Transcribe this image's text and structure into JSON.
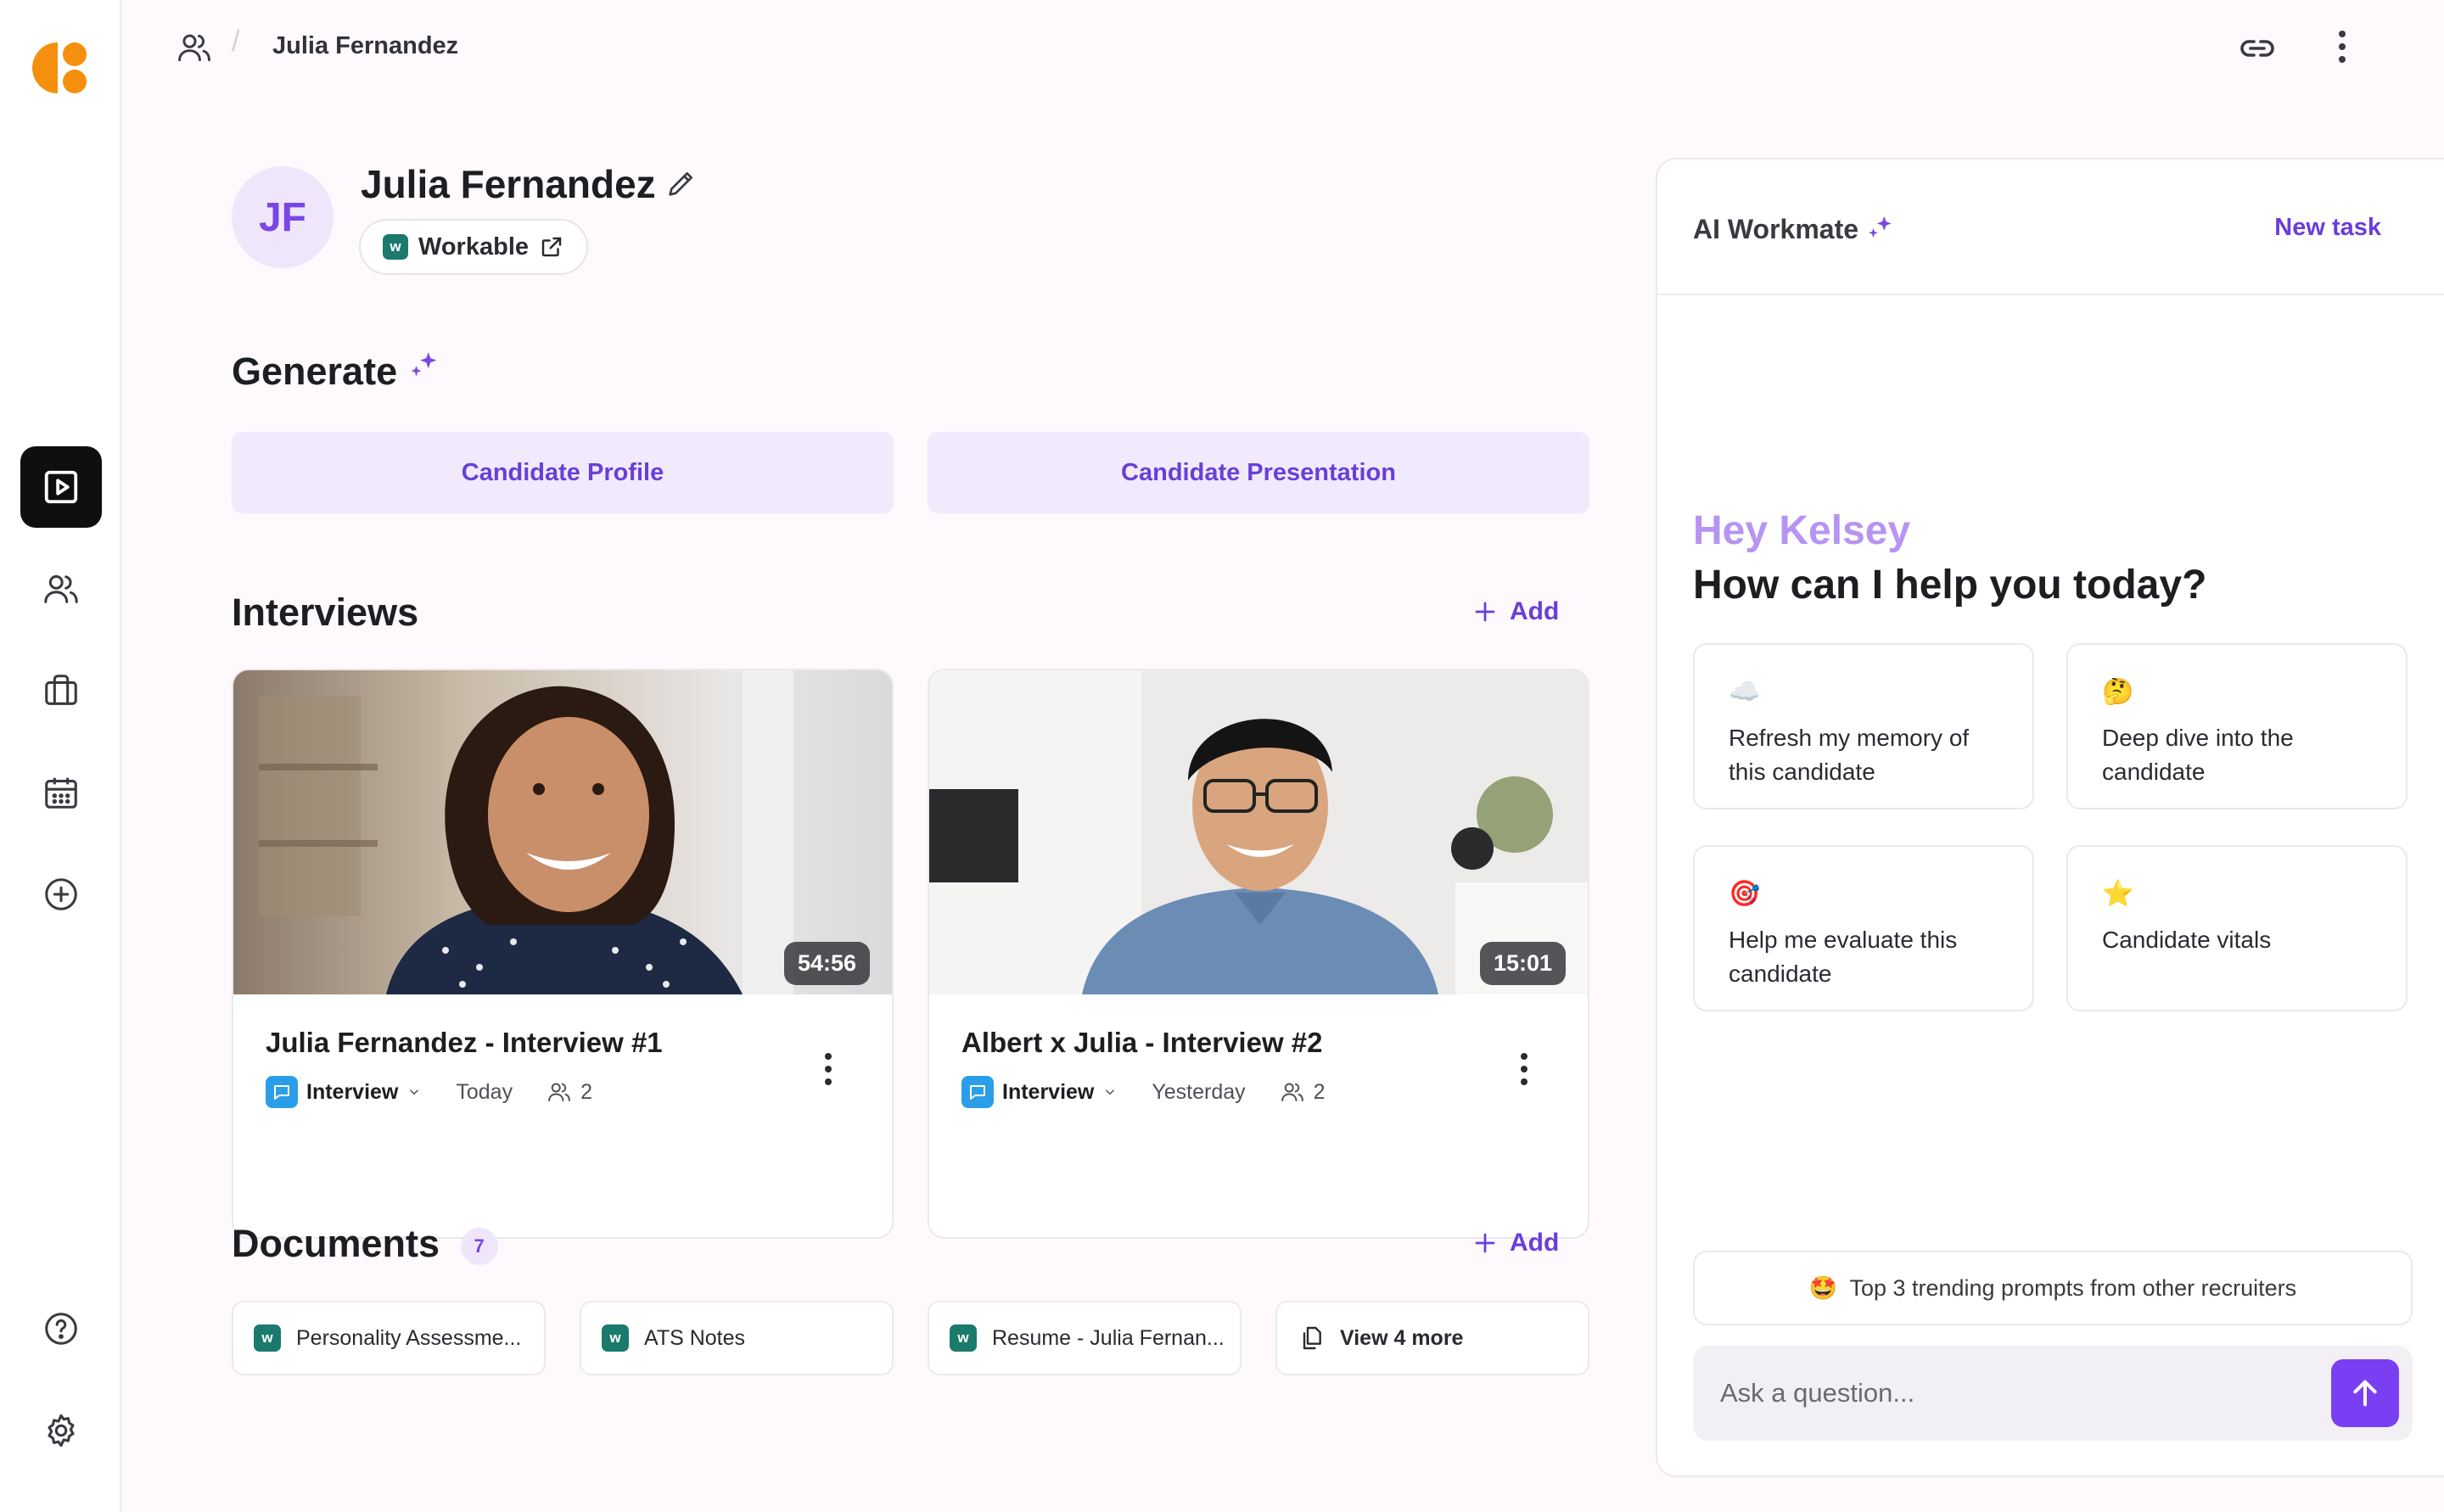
{
  "breadcrumb": {
    "icon": "users-icon",
    "current": "Julia Fernandez"
  },
  "candidate": {
    "initials": "JF",
    "name": "Julia Fernandez",
    "source": "Workable"
  },
  "generate": {
    "title": "Generate",
    "buttons": [
      "Candidate Profile",
      "Candidate Presentation"
    ]
  },
  "interviews": {
    "title": "Interviews",
    "add_label": "Add",
    "items": [
      {
        "title": "Julia Fernandez - Interview #1",
        "duration": "54:56",
        "type": "Interview",
        "when": "Today",
        "participants": "2"
      },
      {
        "title": "Albert x Julia - Interview #2",
        "duration": "15:01",
        "type": "Interview",
        "when": "Yesterday",
        "participants": "2"
      }
    ]
  },
  "documents": {
    "title": "Documents",
    "count": "7",
    "add_label": "Add",
    "items": [
      "Personality Assessme...",
      "ATS Notes",
      "Resume - Julia Fernan..."
    ],
    "view_more": "View 4 more"
  },
  "ai": {
    "title": "AI Workmate",
    "new_task": "New task",
    "greeting": "Hey Kelsey",
    "question": "How can I help you today?",
    "suggestions": [
      {
        "emoji": "☁️",
        "text": "Refresh my memory of this candidate"
      },
      {
        "emoji": "🤔",
        "text": "Deep dive into the candidate"
      },
      {
        "emoji": "🎯",
        "text": "Help me evaluate this candidate"
      },
      {
        "emoji": "⭐",
        "text": "Candidate vitals"
      }
    ],
    "trending_emoji": "🤩",
    "trending": "Top 3 trending prompts from other recruiters",
    "input_placeholder": "Ask a question..."
  },
  "colors": {
    "accent": "#6a3ed8",
    "send": "#7a3ff2",
    "logo": "#f5900f",
    "workable": "#1a7a6c",
    "interview_icon": "#2a9ee8"
  }
}
